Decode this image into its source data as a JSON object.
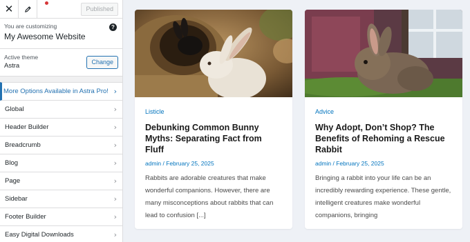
{
  "toolbar": {
    "close_glyph": "✕",
    "publish_label": "Published"
  },
  "customizing": {
    "label": "You are customizing",
    "site_name": "My Awesome Website",
    "help_glyph": "?"
  },
  "theme": {
    "label": "Active theme",
    "name": "Astra",
    "change_label": "Change"
  },
  "promo": {
    "label": "More Options Available in Astra Pro!"
  },
  "menu": [
    {
      "label": "Global"
    },
    {
      "label": "Header Builder"
    },
    {
      "label": "Breadcrumb"
    },
    {
      "label": "Blog"
    },
    {
      "label": "Page"
    },
    {
      "label": "Sidebar"
    },
    {
      "label": "Footer Builder"
    },
    {
      "label": "Easy Digital Downloads"
    }
  ],
  "posts": [
    {
      "category": "Listicle",
      "title": "Debunking Common Bunny Myths: Separating Fact from Fluff",
      "meta": "admin / February 25, 2025",
      "excerpt": "Rabbits are adorable creatures that make wonderful companions. However, there are many misconceptions about rabbits that can lead to confusion [...]"
    },
    {
      "category": "Advice",
      "title": "Why Adopt, Don’t Shop? The Benefits of Rehoming a Rescue Rabbit",
      "meta": "admin / February 25, 2025",
      "excerpt": "Bringing a rabbit into your life can be an incredibly rewarding experience. These gentle, intelligent creatures make wonderful companions, bringing"
    }
  ],
  "colors": {
    "accent": "#2271b1",
    "link": "#0274be",
    "notification_dot": "#d63638"
  }
}
